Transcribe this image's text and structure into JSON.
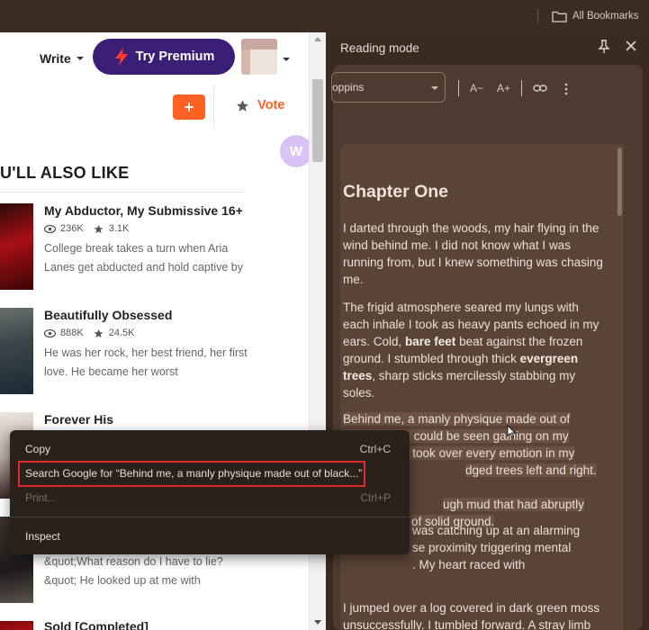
{
  "bookmarks": {
    "label": "All Bookmarks",
    "icon": "folder-icon"
  },
  "header": {
    "write_label": "Write",
    "premium_label": "Try Premium",
    "add_label": "+",
    "vote_label": "Vote",
    "badge_label": "W"
  },
  "section": {
    "title": "U'LL ALSO LIKE"
  },
  "books": [
    {
      "title": "My Abductor, My Submissive 16+",
      "reads": "236K",
      "votes": "3.1K",
      "desc": "College break takes a turn when Aria Lanes get abducted and hold captive by"
    },
    {
      "title": "Beautifully Obsessed",
      "reads": "888K",
      "votes": "24.5K",
      "desc": "He was her rock, her best friend, her first love. He became her worst"
    },
    {
      "title": "Forever His",
      "reads": "",
      "votes": "",
      "desc": ""
    },
    {
      "title": "",
      "reads": "",
      "votes": "",
      "desc": "&quot;What reason do I have to lie? &quot; He looked up at me with"
    },
    {
      "title": "Sold [Completed]",
      "reads": "",
      "votes": "",
      "desc": ""
    }
  ],
  "reader": {
    "title": "Reading mode",
    "font": "oppins",
    "decrease": "A−",
    "increase": "A+",
    "chapter": "Chapter One",
    "p1": "I darted through the woods, my hair flying in the wind behind me. I did not know what I was running from, but I knew something was chasing me.",
    "p2a": "The frigid atmosphere seared my lungs with each inhale I took as heavy pants echoed in my ears. Cold, ",
    "p2b": "bare feet",
    "p2c": " beat against the frozen ground. I stumbled through thick ",
    "p2d": "evergreen trees",
    "p2e": ", sharp sticks mercilessly stabbing my soles.",
    "p3_l1": "Behind me, a manly physique made out of",
    "p3_l2": "black smoke could be seen gaining on my",
    "p3_l3": "heels. Panic took over every emotion in my",
    "p3_l4": "dged trees left and right. Limber",
    "p3_l5": "ugh mud that had abruptly",
    "p3_l6": "of solid ground.",
    "p4_l1": "was catching up at an alarming",
    "p4_l2": "se proximity triggering mental",
    "p4_l3": ". My heart raced with",
    "p5": "I jumped over a log covered in dark green moss unsuccessfully. I tumbled forward. A stray limb from the tree had caused my"
  },
  "context_menu": {
    "copy": "Copy",
    "copy_shortcut": "Ctrl+C",
    "search": "Search Google for “Behind me, a manly physique made out of black...”",
    "print": "Print...",
    "print_shortcut": "Ctrl+P",
    "inspect": "Inspect"
  },
  "colors": {
    "premium": "#3b1f77",
    "accent": "#ff6122",
    "highlight_border": "#e02b2b"
  }
}
